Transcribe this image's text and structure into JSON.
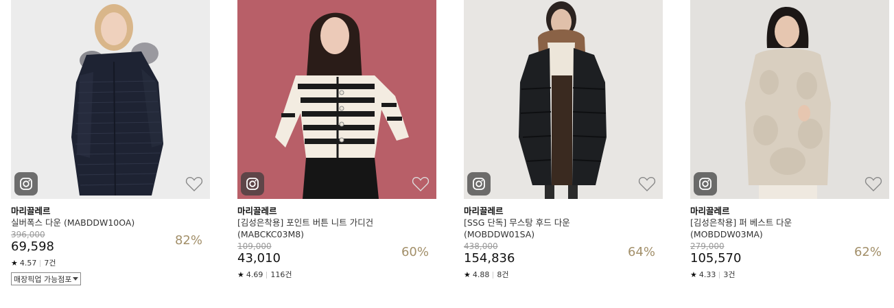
{
  "products": [
    {
      "brand": "마리끌레르",
      "name": "실버폭스 다운 (MABDDW10OA)",
      "original_price": "396,000",
      "price": "69,598",
      "discount": "82%",
      "rating": "4.57",
      "reviews": "7건",
      "pickup_label": "매장픽업 가능점포",
      "image_bg": "#ececec",
      "icons": [
        "instagram-icon",
        "heart-icon"
      ]
    },
    {
      "brand": "마리끌레르",
      "name": "[김성은착용] 포인트 버튼 니트 가디건",
      "name_line2": "(MABCKC03M8)",
      "original_price": "109,000",
      "price": "43,010",
      "discount": "60%",
      "rating": "4.69",
      "reviews": "116건",
      "image_bg": "#b85f68",
      "icons": [
        "instagram-icon",
        "heart-icon"
      ]
    },
    {
      "brand": "마리끌레르",
      "name": "[SSG 단독] 무스탕 후드 다운",
      "name_line2": "(MOBDDW01SA)",
      "original_price": "438,000",
      "price": "154,836",
      "discount": "64%",
      "rating": "4.88",
      "reviews": "8건",
      "image_bg": "#e8e6e3",
      "icons": [
        "instagram-icon",
        "heart-icon"
      ]
    },
    {
      "brand": "마리끌레르",
      "name": "[김성은착용] 퍼 베스트 다운",
      "name_line2": "(MOBDDW03MA)",
      "original_price": "279,000",
      "price": "105,570",
      "discount": "62%",
      "rating": "4.33",
      "reviews": "3건",
      "image_bg": "#e3e1de",
      "icons": [
        "instagram-icon",
        "heart-icon"
      ]
    }
  ],
  "colors": {
    "discount": "#a28f69",
    "strike": "#999999"
  }
}
